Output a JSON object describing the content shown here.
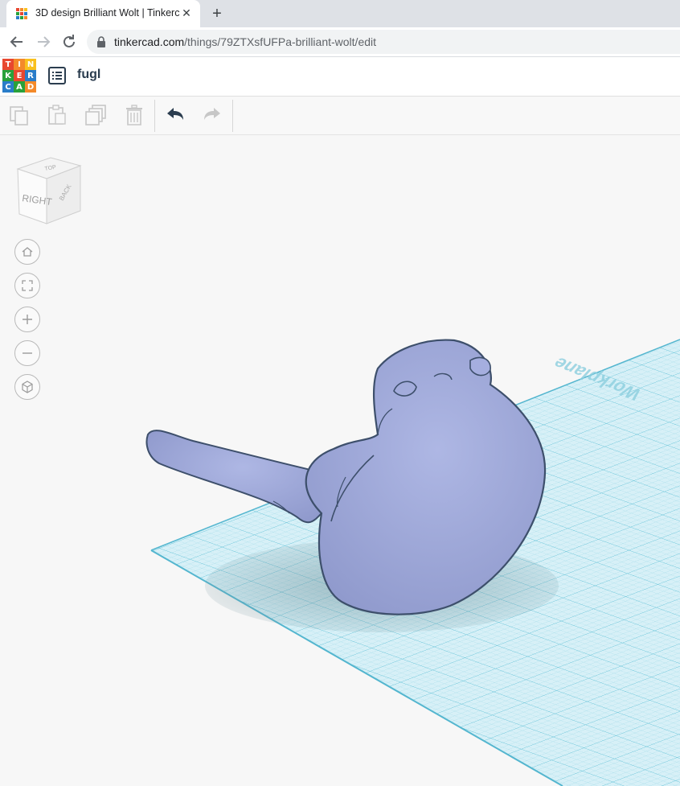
{
  "browser": {
    "tab_title": "3D design Brilliant Wolt | Tinkercad",
    "tab_close": "✕",
    "new_tab": "+",
    "url_host": "tinkercad.com",
    "url_path": "/things/79ZTXsfUFPa-brilliant-wolt/edit"
  },
  "app": {
    "logo_letters": [
      "T",
      "I",
      "N",
      "K",
      "E",
      "R",
      "C",
      "A",
      "D"
    ],
    "logo_colors": [
      "#e8472f",
      "#f48a2a",
      "#f9c01e",
      "#29a13b",
      "#e8472f",
      "#2a7dc9",
      "#2a7dc9",
      "#29a13b",
      "#f48a2a"
    ],
    "design_name": "fugl"
  },
  "toolbar": {
    "icons": [
      "copy-icon",
      "paste-icon",
      "duplicate-icon",
      "delete-icon",
      "undo-icon",
      "redo-icon"
    ]
  },
  "viewcube": {
    "faces": [
      "TOP",
      "RIGHT",
      "BACK"
    ]
  },
  "view_controls": [
    "home-view-icon",
    "fit-view-icon",
    "zoom-in-icon",
    "zoom-out-icon",
    "ortho-view-icon"
  ],
  "workplane": {
    "label": "Workplane",
    "grid_color": "#7ecfe0",
    "shape_color": "#9ea8d8"
  }
}
